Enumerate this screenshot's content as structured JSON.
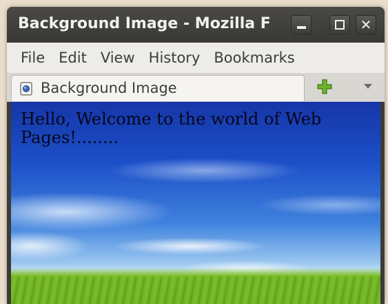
{
  "window": {
    "title": "Background Image - Mozilla F",
    "minimize_label": "",
    "maximize_label": "",
    "close_label": "✕"
  },
  "menubar": {
    "items": [
      {
        "label": "File"
      },
      {
        "label": "Edit"
      },
      {
        "label": "View"
      },
      {
        "label": "History"
      },
      {
        "label": "Bookmarks"
      }
    ]
  },
  "tabs": {
    "active_label": "Background Image",
    "favicon": "page-icon",
    "new_tab_icon": "plus-icon",
    "tab_list_icon": "chevron-down-icon"
  },
  "content": {
    "text": "Hello, Welcome to the world of Web Pages!........"
  },
  "colors": {
    "titlebar": "#3c3b37",
    "menubar": "#edece8",
    "new_tab_plus": "#6db32b"
  }
}
